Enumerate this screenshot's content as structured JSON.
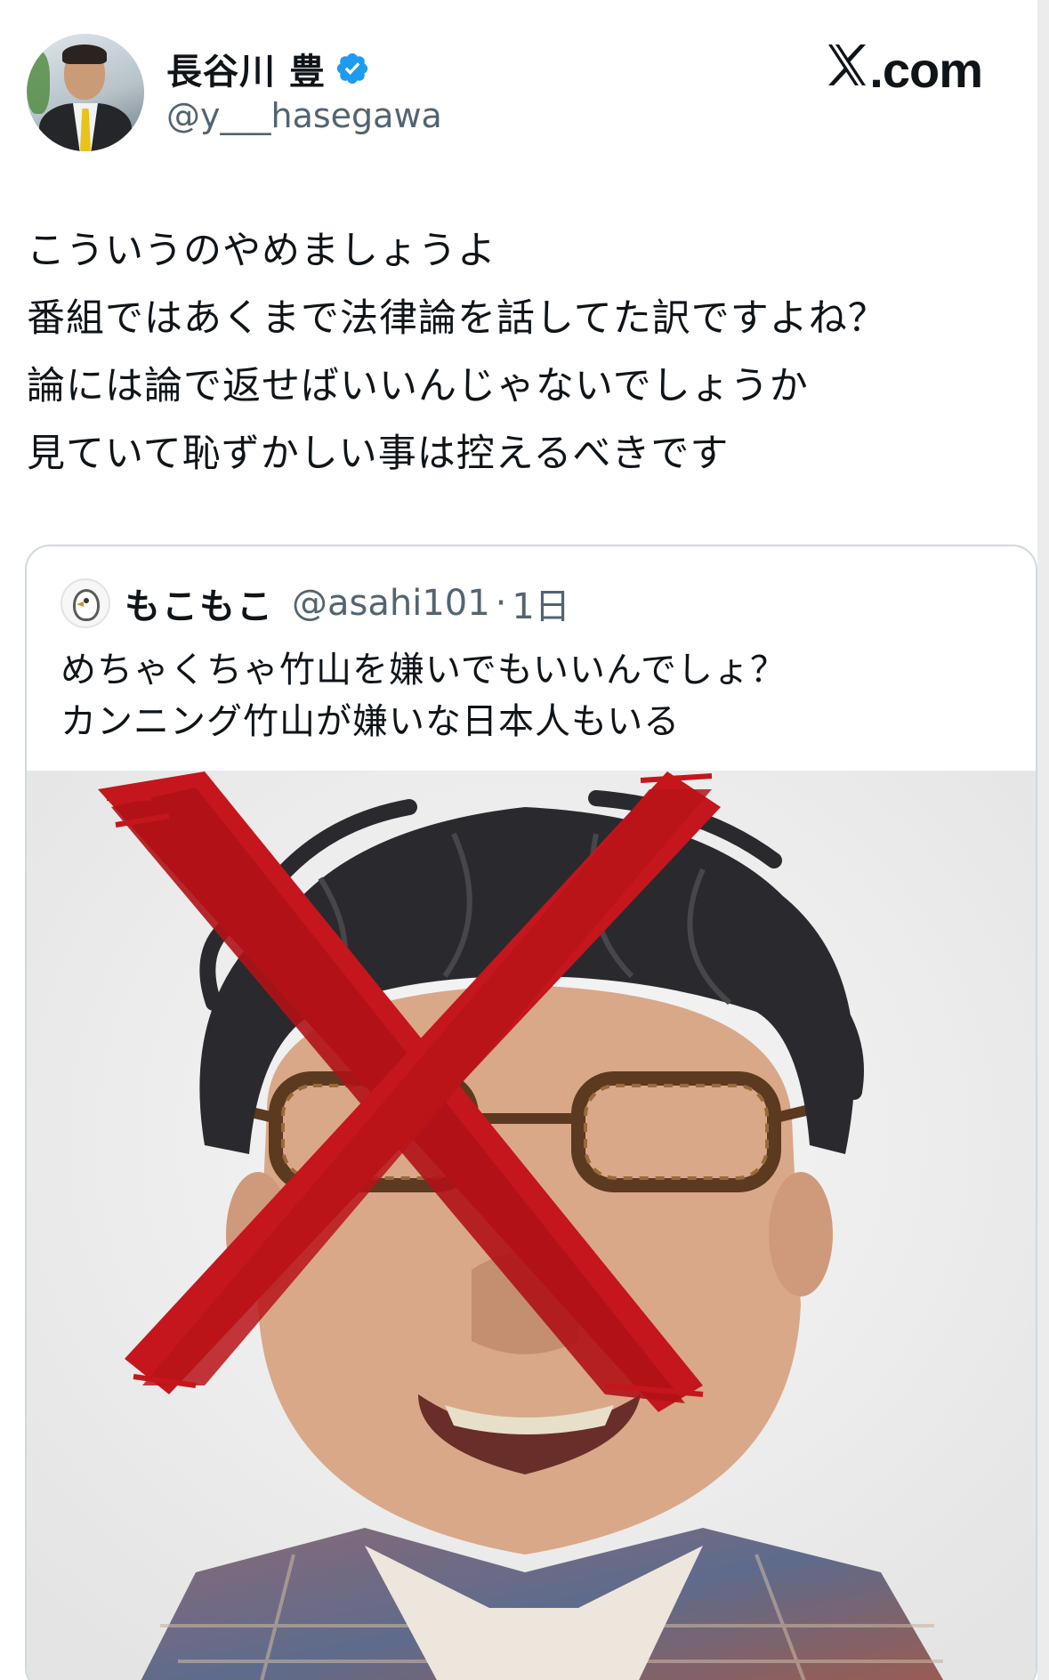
{
  "source_logo": {
    "x_mark": "X",
    "suffix": ".com"
  },
  "author": {
    "display_name": "長谷川 豊",
    "handle": "@y___hasegawa",
    "verified": true,
    "verified_color": "#1d9bf0"
  },
  "tweet": {
    "lines": [
      "こういうのやめましょうよ",
      "番組ではあくまで法律論を話してた訳ですよね？",
      "論には論で返せばいいんじゃないでしょうか",
      "見ていて恥ずかしい事は控えるべきです"
    ]
  },
  "quoted_tweet": {
    "display_name": "もこもこ",
    "handle": "@asahi101",
    "separator": "·",
    "time": "1日",
    "lines": [
      "めちゃくちゃ竹山を嫌いでもいいんでしょ？",
      "カンニング竹山が嫌いな日本人もいる"
    ]
  },
  "colors": {
    "text": "#0f1419",
    "secondary": "#536471",
    "border": "#cfd9de",
    "red_x": "#c4161c"
  }
}
